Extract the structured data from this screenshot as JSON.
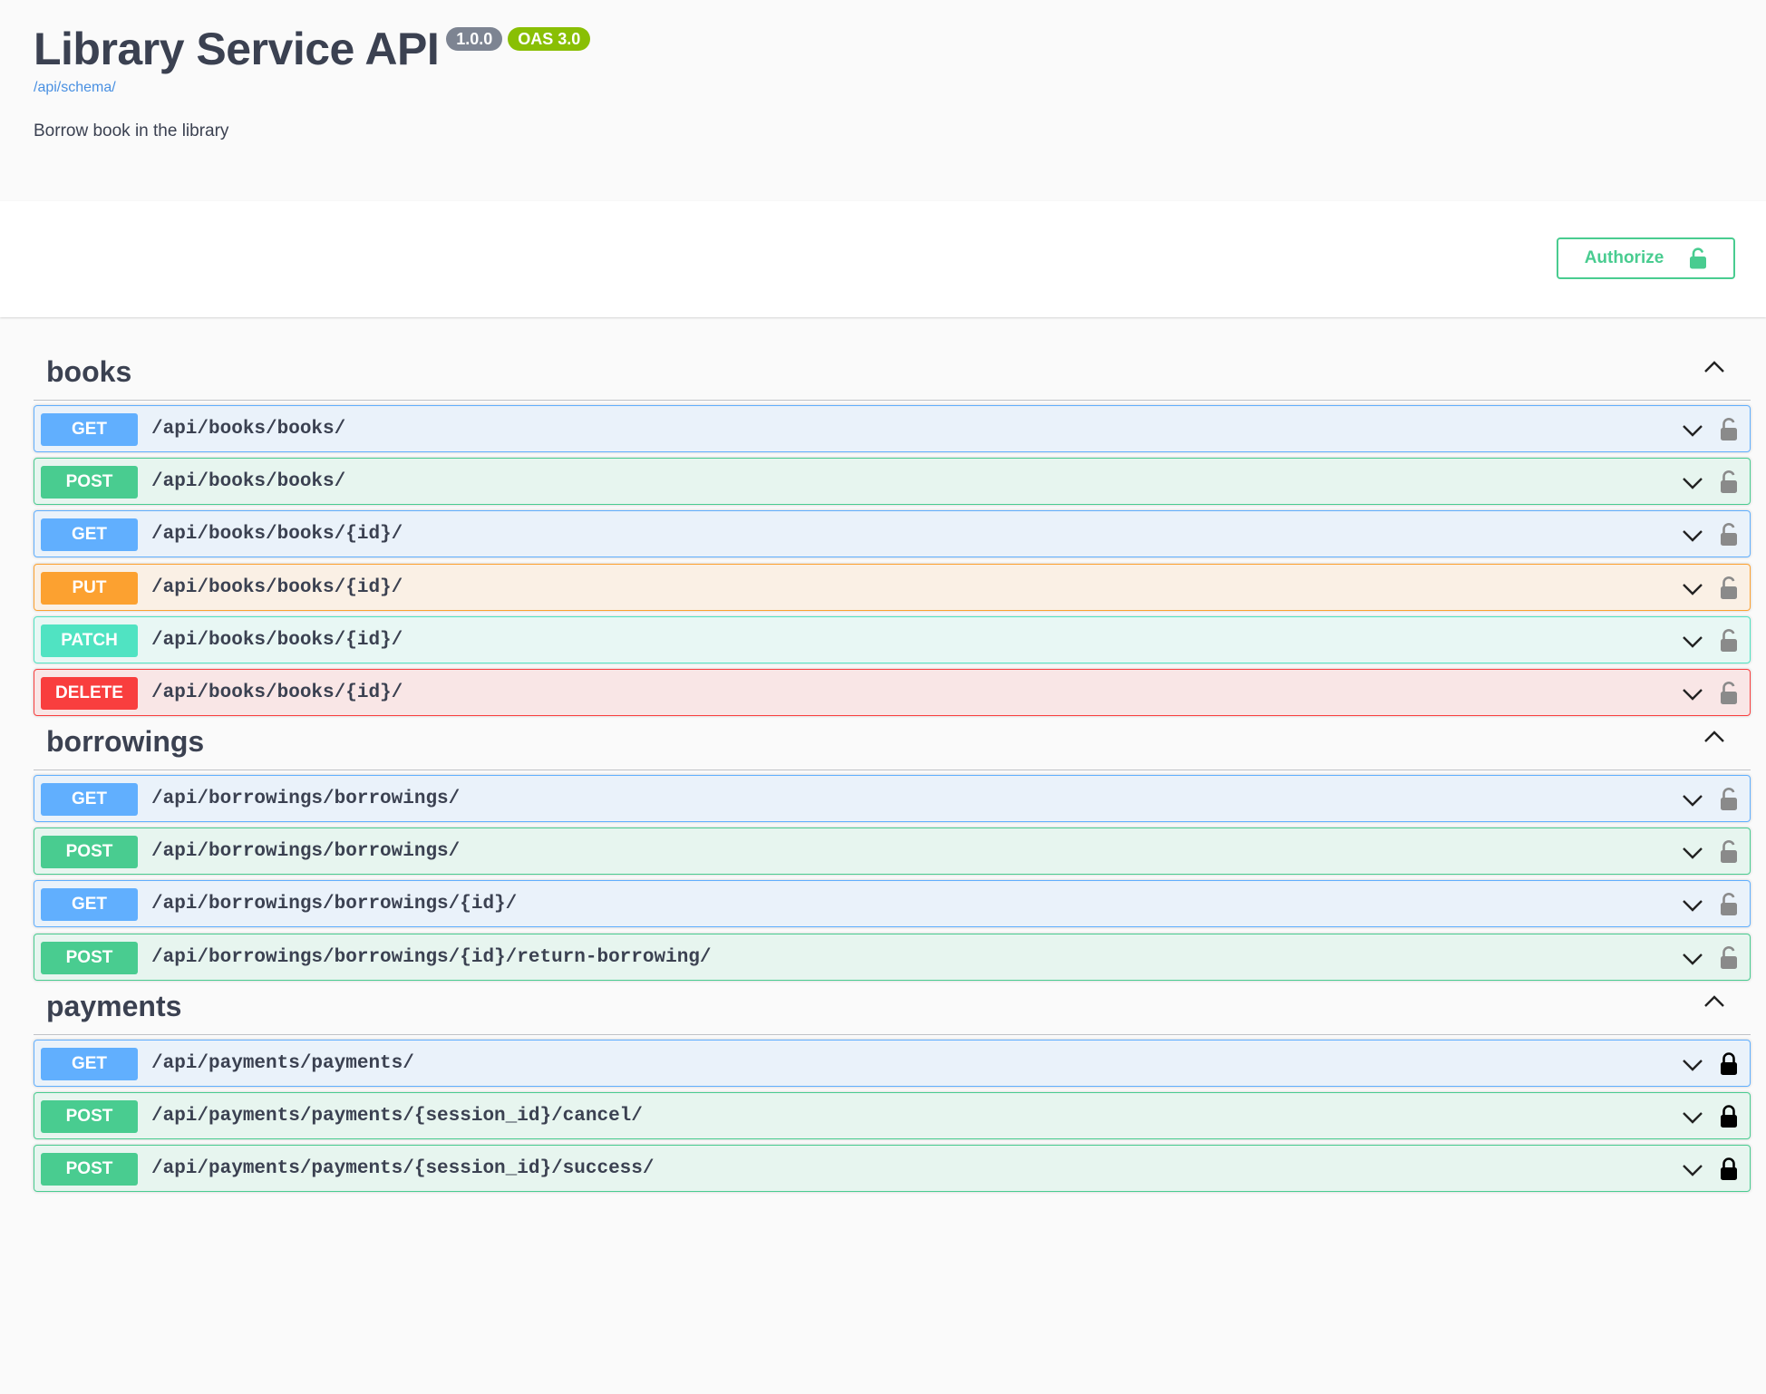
{
  "info": {
    "title": "Library Service API",
    "version": "1.0.0",
    "oas": "OAS 3.0",
    "schema_link": "/api/schema/",
    "description": "Borrow book in the library"
  },
  "scheme": {
    "authorize_label": "Authorize",
    "authorize_icon": "unlocked-icon"
  },
  "colors": {
    "get": "#61affe",
    "post": "#49cc90",
    "put": "#fca130",
    "patch": "#50e3c2",
    "delete": "#f93e3e"
  },
  "tags": [
    {
      "name": "books",
      "toggle_icon": "chevron-up-icon",
      "operations": [
        {
          "method": "GET",
          "path": "/api/books/books/",
          "lock": "unlocked"
        },
        {
          "method": "POST",
          "path": "/api/books/books/",
          "lock": "unlocked"
        },
        {
          "method": "GET",
          "path": "/api/books/books/{id}/",
          "lock": "unlocked"
        },
        {
          "method": "PUT",
          "path": "/api/books/books/{id}/",
          "lock": "unlocked"
        },
        {
          "method": "PATCH",
          "path": "/api/books/books/{id}/",
          "lock": "unlocked"
        },
        {
          "method": "DELETE",
          "path": "/api/books/books/{id}/",
          "lock": "unlocked"
        }
      ]
    },
    {
      "name": "borrowings",
      "toggle_icon": "chevron-up-icon",
      "operations": [
        {
          "method": "GET",
          "path": "/api/borrowings/borrowings/",
          "lock": "unlocked"
        },
        {
          "method": "POST",
          "path": "/api/borrowings/borrowings/",
          "lock": "unlocked"
        },
        {
          "method": "GET",
          "path": "/api/borrowings/borrowings/{id}/",
          "lock": "unlocked"
        },
        {
          "method": "POST",
          "path": "/api/borrowings/borrowings/{id}/return-borrowing/",
          "lock": "unlocked"
        }
      ]
    },
    {
      "name": "payments",
      "toggle_icon": "chevron-up-icon",
      "operations": [
        {
          "method": "GET",
          "path": "/api/payments/payments/",
          "lock": "locked"
        },
        {
          "method": "POST",
          "path": "/api/payments/payments/{session_id}/cancel/",
          "lock": "locked"
        },
        {
          "method": "POST",
          "path": "/api/payments/payments/{session_id}/success/",
          "lock": "locked"
        }
      ]
    }
  ]
}
